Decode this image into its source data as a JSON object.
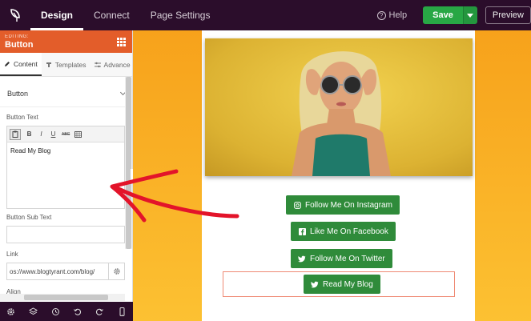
{
  "topbar": {
    "tabs": [
      {
        "label": "Design",
        "active": true
      },
      {
        "label": "Connect",
        "active": false
      },
      {
        "label": "Page Settings",
        "active": false
      }
    ],
    "help_label": "Help",
    "save_label": "Save",
    "preview_label": "Preview"
  },
  "panel": {
    "editing_label": "EDITING:",
    "title": "Button",
    "tabs": [
      {
        "label": "Content",
        "icon": "pencil-icon"
      },
      {
        "label": "Templates",
        "icon": "template-icon"
      },
      {
        "label": "Advance",
        "icon": "sliders-icon"
      }
    ],
    "section_title": "Button",
    "button_text_label": "Button Text",
    "toolbar": [
      "B",
      "I",
      "U",
      "ABC"
    ],
    "button_text_value": "Read My Blog",
    "sub_text_label": "Button Sub Text",
    "sub_text_value": "",
    "link_label": "Link",
    "link_value": "os://www.blogtyrant.com/blog/",
    "align_label": "Align",
    "footer_icons": [
      "gear-icon",
      "layers-icon",
      "history-icon",
      "undo-icon",
      "redo-icon",
      "mobile-icon"
    ]
  },
  "canvas": {
    "buttons": [
      {
        "label": "Follow Me On Instagram",
        "icon": "instagram-icon"
      },
      {
        "label": "Like Me On Facebook",
        "icon": "facebook-icon"
      },
      {
        "label": "Follow Me On Twitter",
        "icon": "twitter-icon"
      },
      {
        "label": "Read My Blog",
        "icon": "twitter-icon"
      }
    ],
    "colors": {
      "button": "#2f8b3a",
      "background_top": "#f7a21b",
      "background_bottom": "#fcc132",
      "accent": "#e35d2a",
      "annotation_arrow": "#e3142a"
    }
  }
}
